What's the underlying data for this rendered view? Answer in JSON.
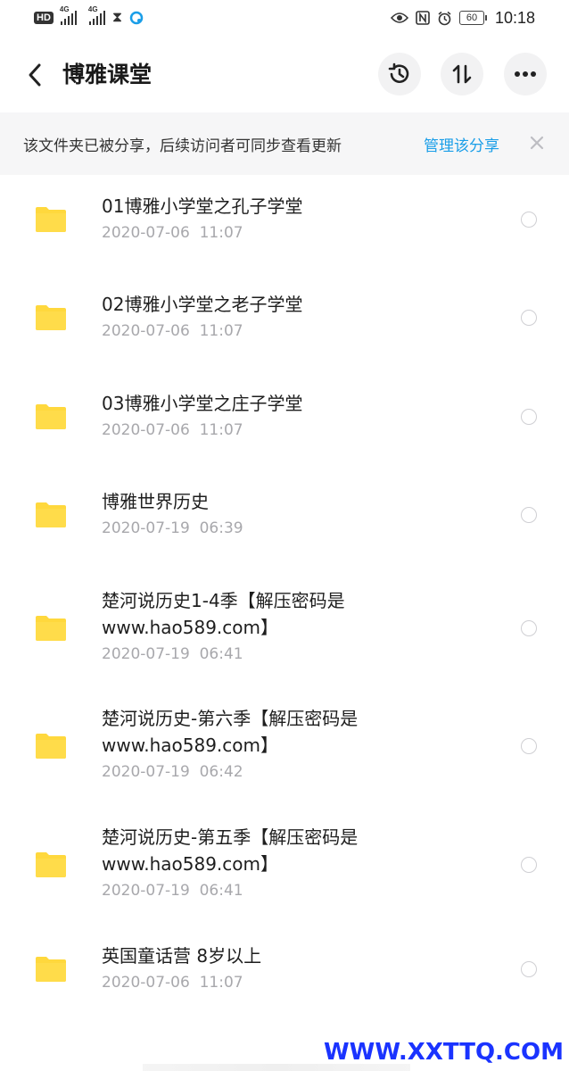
{
  "status_bar": {
    "left_badges": [
      "HD",
      "4G",
      "4G"
    ],
    "battery": "60",
    "time": "10:18",
    "icons": [
      "hd-icon",
      "signal-4g-icon",
      "signal-4g-icon",
      "hourglass-icon",
      "app-notification-icon",
      "eye-icon",
      "nfc-icon",
      "alarm-icon",
      "battery-icon"
    ]
  },
  "header": {
    "title": "博雅课堂",
    "icons": [
      "back-arrow-icon",
      "history-icon",
      "sort-icon",
      "more-icon"
    ]
  },
  "banner": {
    "text": "该文件夹已被分享，后续访问者可同步查看更新",
    "link": "管理该分享",
    "close_icon": "close-icon"
  },
  "files": [
    {
      "name": "01博雅小学堂之孔子学堂",
      "date": "2020-07-06  11:07"
    },
    {
      "name": "02博雅小学堂之老子学堂",
      "date": "2020-07-06  11:07"
    },
    {
      "name": "03博雅小学堂之庄子学堂",
      "date": "2020-07-06  11:07"
    },
    {
      "name": "博雅世界历史",
      "date": "2020-07-19  06:39"
    },
    {
      "name": "楚河说历史1-4季【解压密码是www.hao589.com】",
      "date": "2020-07-19  06:41"
    },
    {
      "name": "楚河说历史-第六季【解压密码是www.hao589.com】",
      "date": "2020-07-19  06:42"
    },
    {
      "name": "楚河说历史-第五季【解压密码是www.hao589.com】",
      "date": "2020-07-19  06:41"
    },
    {
      "name": "英国童话营 8岁以上",
      "date": "2020-07-06  11:07"
    }
  ],
  "watermark": "WWW.XXTTQ.COM",
  "colors": {
    "folder": "#ffd83d",
    "link": "#1a9ee8",
    "date": "#a8a8ac",
    "banner_bg": "#f6f6f7",
    "watermark": "#1a33ff"
  }
}
